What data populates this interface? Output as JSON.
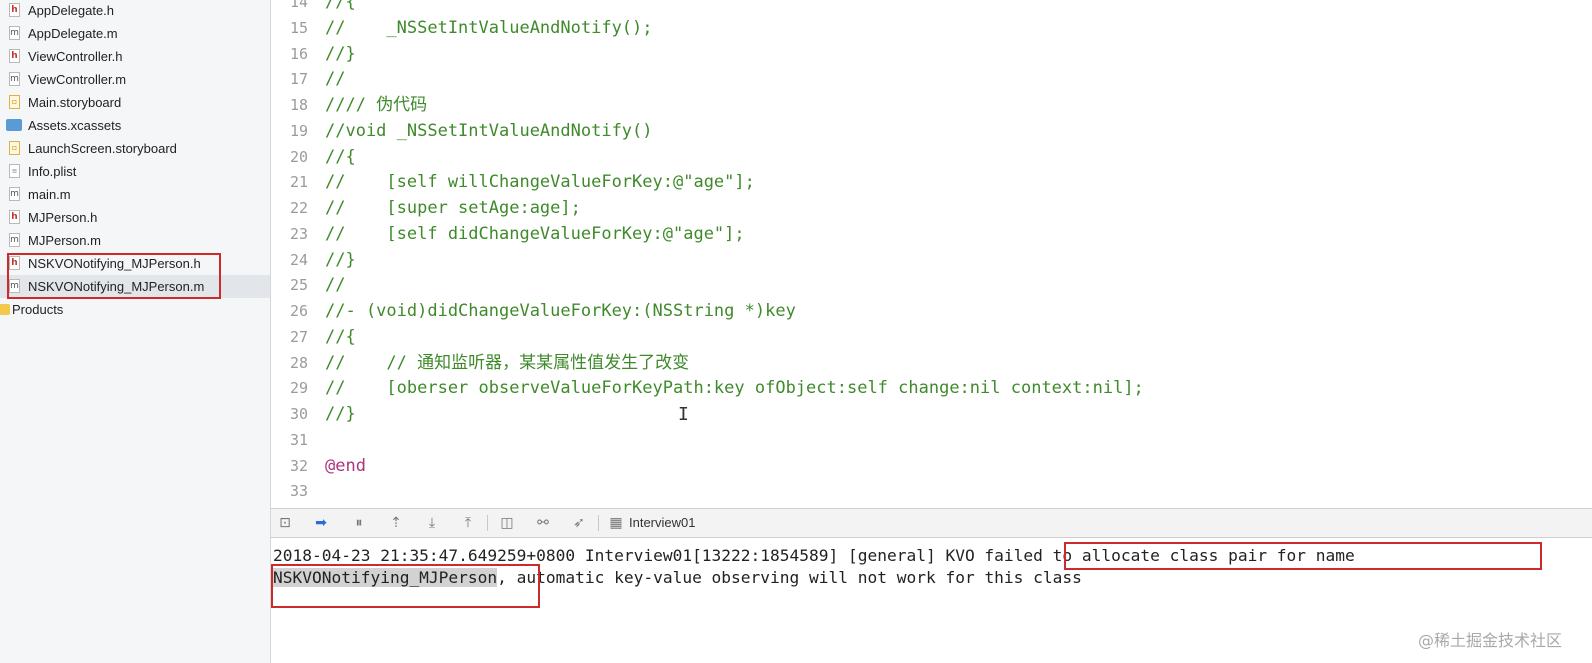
{
  "navigator": {
    "files": [
      {
        "name": "AppDelegate.h",
        "icon": "h",
        "icon_name": "header-file-icon"
      },
      {
        "name": "AppDelegate.m",
        "icon": "m",
        "icon_name": "implementation-file-icon"
      },
      {
        "name": "ViewController.h",
        "icon": "h",
        "icon_name": "header-file-icon"
      },
      {
        "name": "ViewController.m",
        "icon": "m",
        "icon_name": "implementation-file-icon"
      },
      {
        "name": "Main.storyboard",
        "icon": "sb",
        "icon_name": "storyboard-file-icon"
      },
      {
        "name": "Assets.xcassets",
        "icon": "assets",
        "icon_name": "asset-catalog-icon"
      },
      {
        "name": "LaunchScreen.storyboard",
        "icon": "sb",
        "icon_name": "storyboard-file-icon"
      },
      {
        "name": "Info.plist",
        "icon": "plist",
        "icon_name": "plist-file-icon"
      },
      {
        "name": "main.m",
        "icon": "m",
        "icon_name": "implementation-file-icon"
      },
      {
        "name": "MJPerson.h",
        "icon": "h",
        "icon_name": "header-file-icon"
      },
      {
        "name": "MJPerson.m",
        "icon": "m",
        "icon_name": "implementation-file-icon"
      },
      {
        "name": "NSKVONotifying_MJPerson.h",
        "icon": "h",
        "icon_name": "header-file-icon"
      },
      {
        "name": "NSKVONotifying_MJPerson.m",
        "icon": "m",
        "icon_name": "implementation-file-icon",
        "selected": true
      }
    ],
    "folder": {
      "name": "Products",
      "icon_name": "folder-icon"
    }
  },
  "editor": {
    "lines": [
      {
        "no": "14",
        "code": "//{"
      },
      {
        "no": "15",
        "code": "//    _NSSetIntValueAndNotify();"
      },
      {
        "no": "16",
        "code": "//}"
      },
      {
        "no": "17",
        "code": "//"
      },
      {
        "no": "18",
        "code": "//// 伪代码"
      },
      {
        "no": "19",
        "code": "//void _NSSetIntValueAndNotify()"
      },
      {
        "no": "20",
        "code": "//{"
      },
      {
        "no": "21",
        "code": "//    [self willChangeValueForKey:@\"age\"];"
      },
      {
        "no": "22",
        "code": "//    [super setAge:age];"
      },
      {
        "no": "23",
        "code": "//    [self didChangeValueForKey:@\"age\"];"
      },
      {
        "no": "24",
        "code": "//}"
      },
      {
        "no": "25",
        "code": "//"
      },
      {
        "no": "26",
        "code": "//- (void)didChangeValueForKey:(NSString *)key"
      },
      {
        "no": "27",
        "code": "//{"
      },
      {
        "no": "28",
        "code": "//    // 通知监听器，某某属性值发生了改变"
      },
      {
        "no": "29",
        "code": "//    [oberser observeValueForKeyPath:key ofObject:self change:nil context:nil];"
      },
      {
        "no": "30",
        "code": "//}"
      },
      {
        "no": "31",
        "code": ""
      },
      {
        "no": "32",
        "code": "@end",
        "keyword": true
      },
      {
        "no": "33",
        "code": ""
      }
    ],
    "cursor_glyph": "I"
  },
  "debug_bar": {
    "target": "Interview01",
    "buttons": [
      {
        "name": "hide-debug-area-icon",
        "glyph": "⊡"
      },
      {
        "name": "breakpoints-toggle-icon",
        "glyph": "➡",
        "active": true
      },
      {
        "name": "pause-icon",
        "glyph": "⏸"
      },
      {
        "name": "step-over-icon",
        "glyph": "⇡"
      },
      {
        "name": "step-into-icon",
        "glyph": "⤓"
      },
      {
        "name": "step-out-icon",
        "glyph": "⤒"
      },
      {
        "name": "view-hierarchy-icon",
        "glyph": "◫"
      },
      {
        "name": "memory-graph-icon",
        "glyph": "⚯"
      },
      {
        "name": "simulate-location-icon",
        "glyph": "➶"
      }
    ]
  },
  "console": {
    "line1_pre": "2018-04-23 21:35:47.649259+0800 Interview01[13222:1854589] [general] ",
    "line1_boxed": "KVO failed to allocate class pair for name",
    "line2_selected": "NSKVONotifying_MJPerson",
    "line2_rest": ", automatic key-value observing will not work for this class"
  },
  "watermark": "@稀土掘金技术社区",
  "colors": {
    "comment": "#3f8a2b",
    "keyword": "#b0327c",
    "highlight_box": "#cc2b2b",
    "line_number": "#9b9b9b"
  }
}
